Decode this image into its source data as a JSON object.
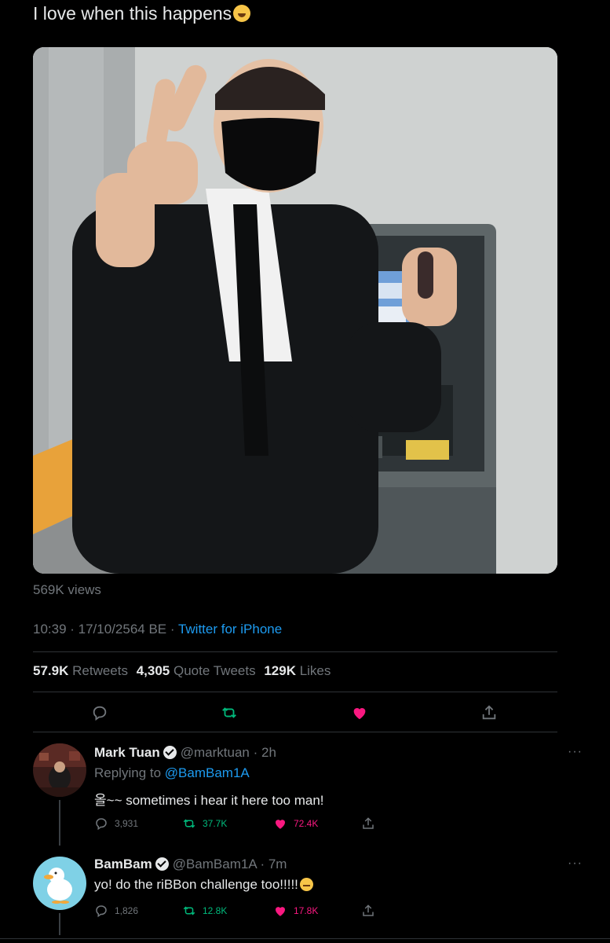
{
  "tweet": {
    "text": "I love when this happens",
    "views": "569K views",
    "time": "10:39 · 17/10/2564 BE · ",
    "source": "Twitter for iPhone"
  },
  "stats": {
    "retweets_count": "57.9K",
    "retweets_label": "Retweets",
    "quotes_count": "4,305",
    "quotes_label": "Quote Tweets",
    "likes_count": "129K",
    "likes_label": "Likes"
  },
  "icons": {
    "reply": "reply-icon",
    "retweet": "retweet-icon",
    "like": "heart-icon",
    "share": "share-icon"
  },
  "colors": {
    "link": "#1d9bf0",
    "retweet": "#00ba7c",
    "like": "#f91880",
    "muted": "#71767b"
  },
  "replies": [
    {
      "name": "Mark Tuan",
      "handle": "@marktuan",
      "time": " · 2h",
      "replying_prefix": "Replying to ",
      "replying_to": "@BamBam1A",
      "text": "올~~ sometimes i hear it here too man!",
      "reply_count": "3,931",
      "retweet_count": "37.7K",
      "like_count": "72.4K"
    },
    {
      "name": "BamBam",
      "handle": "@BamBam1A",
      "time": " · 7m",
      "text": "yo! do the riBBon challenge too!!!!!",
      "reply_count": "1,826",
      "retweet_count": "12.8K",
      "like_count": "17.8K"
    }
  ]
}
